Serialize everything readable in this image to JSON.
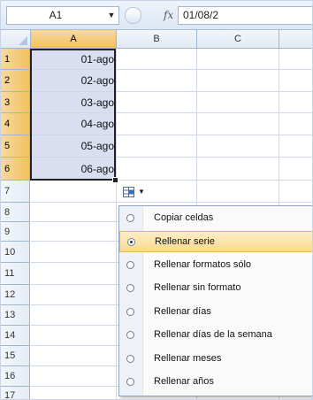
{
  "name_box": "A1",
  "formula_bar": {
    "fx_symbol": "fx",
    "content": "01/08/2"
  },
  "columns": [
    "A",
    "B",
    "C"
  ],
  "rows": [
    "1",
    "2",
    "3",
    "4",
    "5",
    "6",
    "7",
    "8",
    "9",
    "10",
    "11",
    "12",
    "13",
    "14",
    "15",
    "16",
    "17"
  ],
  "cells": {
    "A1": "01-ago",
    "A2": "02-ago",
    "A3": "03-ago",
    "A4": "04-ago",
    "A5": "05-ago",
    "A6": "06-ago"
  },
  "autofill_menu": {
    "items": [
      {
        "label": "Copiar celdas",
        "checked": false
      },
      {
        "label": "Rellenar serie",
        "checked": true
      },
      {
        "label": "Rellenar formatos sólo",
        "checked": false
      },
      {
        "label": "Rellenar sin formato",
        "checked": false
      },
      {
        "label": "Rellenar días",
        "checked": false
      },
      {
        "label": "Rellenar días de la semana",
        "checked": false
      },
      {
        "label": "Rellenar meses",
        "checked": false
      },
      {
        "label": "Rellenar años",
        "checked": false
      }
    ]
  },
  "colors": {
    "selection": "#d9dff1",
    "header_selected": "#f1c15f",
    "menu_highlight": "#f9d98f"
  }
}
